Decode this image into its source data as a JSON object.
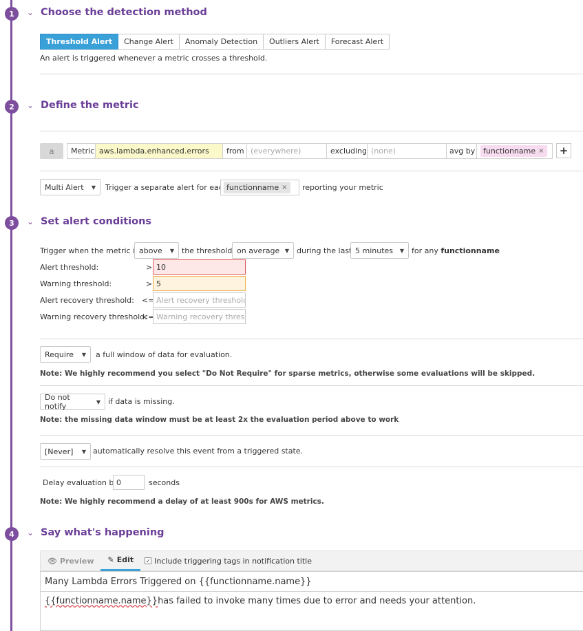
{
  "sections": {
    "s1": {
      "num": "1",
      "title": "Choose the detection method"
    },
    "s2": {
      "num": "2",
      "title": "Define the metric"
    },
    "s3": {
      "num": "3",
      "title": "Set alert conditions"
    },
    "s4": {
      "num": "4",
      "title": "Say what's happening"
    }
  },
  "detection": {
    "methods": [
      "Threshold Alert",
      "Change Alert",
      "Anomaly Detection",
      "Outliers Alert",
      "Forecast Alert"
    ],
    "active_index": 0,
    "description": "An alert is triggered whenever a metric crosses a threshold."
  },
  "metric": {
    "letter": "a",
    "metric_label": "Metric",
    "metric_value": "aws.lambda.enhanced.errors",
    "from_label": "from",
    "from_placeholder": "(everywhere)",
    "excluding_label": "excluding",
    "excluding_placeholder": "(none)",
    "avgby_label": "avg by",
    "avgby_tag": "functionname",
    "add_symbol": "+",
    "multi_alert": "Multi Alert",
    "trigger_text": "Trigger a separate alert for each",
    "group_tag": "functionname",
    "reporting_text": "reporting your metric"
  },
  "conditions": {
    "trigger_prefix": "Trigger when the metric is",
    "comparison": "above",
    "the_threshold": "the threshold",
    "aggregation": "on average",
    "during": "during the last",
    "window": "5 minutes",
    "for_any": "for any",
    "group": "functionname",
    "alert_label": "Alert threshold:",
    "alert_op": ">",
    "alert_value": "10",
    "warning_label": "Warning threshold:",
    "warning_op": ">",
    "warning_value": "5",
    "alert_recovery_label": "Alert recovery threshold:",
    "alert_recovery_op": "<=",
    "alert_recovery_placeholder": "Alert recovery threshold (",
    "warning_recovery_label": "Warning recovery threshold:",
    "warning_recovery_op": "<=",
    "warning_recovery_placeholder": "Warning recovery thresho",
    "require": "Require",
    "require_text": "a full window of data for evaluation.",
    "require_note": "Note: We highly recommend you select \"Do Not Require\" for sparse metrics, otherwise some evaluations will be skipped.",
    "notify": "Do not notify",
    "notify_text": "if data is missing.",
    "notify_note": "Note: the missing data window must be at least 2x the evaluation period above to work",
    "resolve": "[Never]",
    "resolve_text": "automatically resolve this event from a triggered state.",
    "delay_label": "Delay evaluation by",
    "delay_value": "0",
    "delay_unit": "seconds",
    "delay_note": "Note: We highly recommend a delay of at least 900s for AWS metrics."
  },
  "message": {
    "preview_tab": "Preview",
    "edit_tab": "Edit",
    "include_tags": "Include triggering tags in notification title",
    "title": "Many Lambda Errors Triggered on {{functionname.name}}",
    "body_var": "{{functionname.name}}",
    "body_rest": " has failed to invoke many times due to error and needs your attention."
  },
  "colors": {
    "accent_purple": "#7d4d9e",
    "active_blue": "#3aa0d8",
    "alert_border": "#e0585c",
    "warning_border": "#f0b050"
  }
}
